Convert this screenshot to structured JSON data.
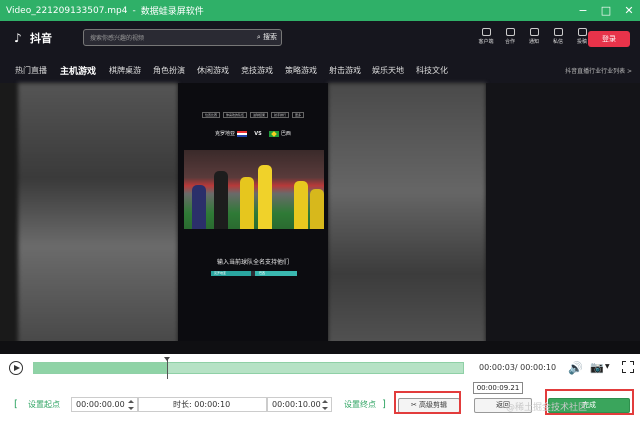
{
  "window": {
    "file_name": "Video_221209133507.mp4",
    "separator": "-",
    "app_name": "数据蛙录屏软件",
    "controls": {
      "minimize": "−",
      "maximize": "□",
      "close": "✕"
    }
  },
  "video": {
    "header": {
      "logo": "抖音",
      "search_placeholder": "搜索你感兴趣的视频",
      "search_button": "搜索",
      "icons": [
        "客户端",
        "合作",
        "通知",
        "私信",
        "投稿"
      ],
      "login": "登录"
    },
    "nav": {
      "items": [
        "热门直播",
        "主机游戏",
        "棋牌桌游",
        "角色扮演",
        "休闲游戏",
        "竞技游戏",
        "策略游戏",
        "射击游戏",
        "娱乐天地",
        "科技文化"
      ],
      "active_index": 1,
      "right_text": "抖音直播行业行业列表 >"
    },
    "phone": {
      "chips": [
        "位置比赛",
        "你喜欢的队伍",
        "进球结果",
        "射手排行",
        "更多"
      ],
      "team_left": "克罗地亚",
      "vs": "VS",
      "team_right": "巴西",
      "prompt": "输入当前球队全名支持他们",
      "bar_left": "克罗地亚",
      "bar_right": "巴西"
    }
  },
  "player": {
    "timecode": "00:00:03/ 00:00:10",
    "progress_fraction": 0.31,
    "tooltip": "00:00:09.21",
    "set_start_label": "设置起点",
    "start_time": "00:00:00.00",
    "duration_label": "时长: 00:00:10",
    "end_time": "00:00:10.00",
    "set_end_label": "设置终点",
    "advanced_cut_label": "高级剪辑",
    "back_label": "返回",
    "done_label": "完成",
    "bracket_left": "[",
    "bracket_right": "]"
  },
  "watermark": "@稀土掘金技术社区",
  "colors": {
    "accent": "#2fb068",
    "highlight_box": "#e23c3c",
    "done_button": "#3aa55c"
  }
}
